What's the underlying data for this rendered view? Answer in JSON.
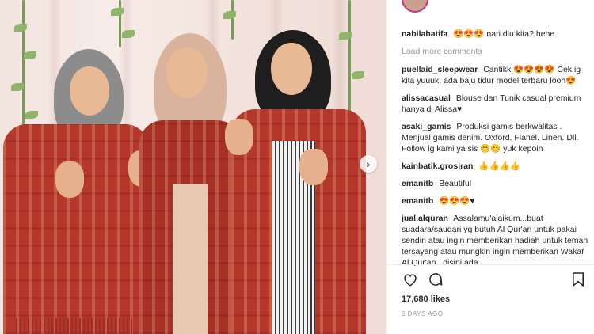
{
  "photo": {
    "alt_description_hidden": "",
    "colors": {
      "shawl": "#b4372c",
      "hijab_grey": "#8c8c8c",
      "hijab_beige": "#d9b39c",
      "hijab_black": "#1e1e1e"
    }
  },
  "comments": [
    {
      "username": "nabilahatifa",
      "text": "😍😍😍 nari dlu kita? hehe"
    },
    {
      "load_more": "Load more comments"
    },
    {
      "username": "puellaid_sleepwear",
      "text": "Cantikk 😍😍😍😍 Cek ig kita yuuuk, ada baju tidur model terbaru looh😍"
    },
    {
      "username": "alissacasual",
      "text": "Blouse dan Tunik casual premium hanya di Alissa♥"
    },
    {
      "username": "asaki_gamis",
      "text": "Produksi gamis berkwalitas . Menjual gamis denim. Oxford. Flanel. Linen. Dll. Follow ig kami ya sis 😊😊 yuk kepoin"
    },
    {
      "username": "kainbatik.grosiran",
      "text": "👍👍👍👍"
    },
    {
      "username": "emanitb",
      "text": "Beautiful"
    },
    {
      "username": "emanitb",
      "text": "😍😍😍♥"
    },
    {
      "username": "jual.alquran",
      "text": "Assalamu'alaikum...buat suadara/saudari yg butuh Al Qur'an untuk pakai sendiri atau ingin memberikan hadiah untuk teman tersayang atau mungkin ingin memberikan Wakaf Al Qur'an...disini ada"
    }
  ],
  "actions": {
    "like_icon": "heart-icon",
    "comment_icon": "comment-icon",
    "save_icon": "bookmark-icon"
  },
  "likes": "17,680 likes",
  "timestamp": "6 DAYS AGO"
}
